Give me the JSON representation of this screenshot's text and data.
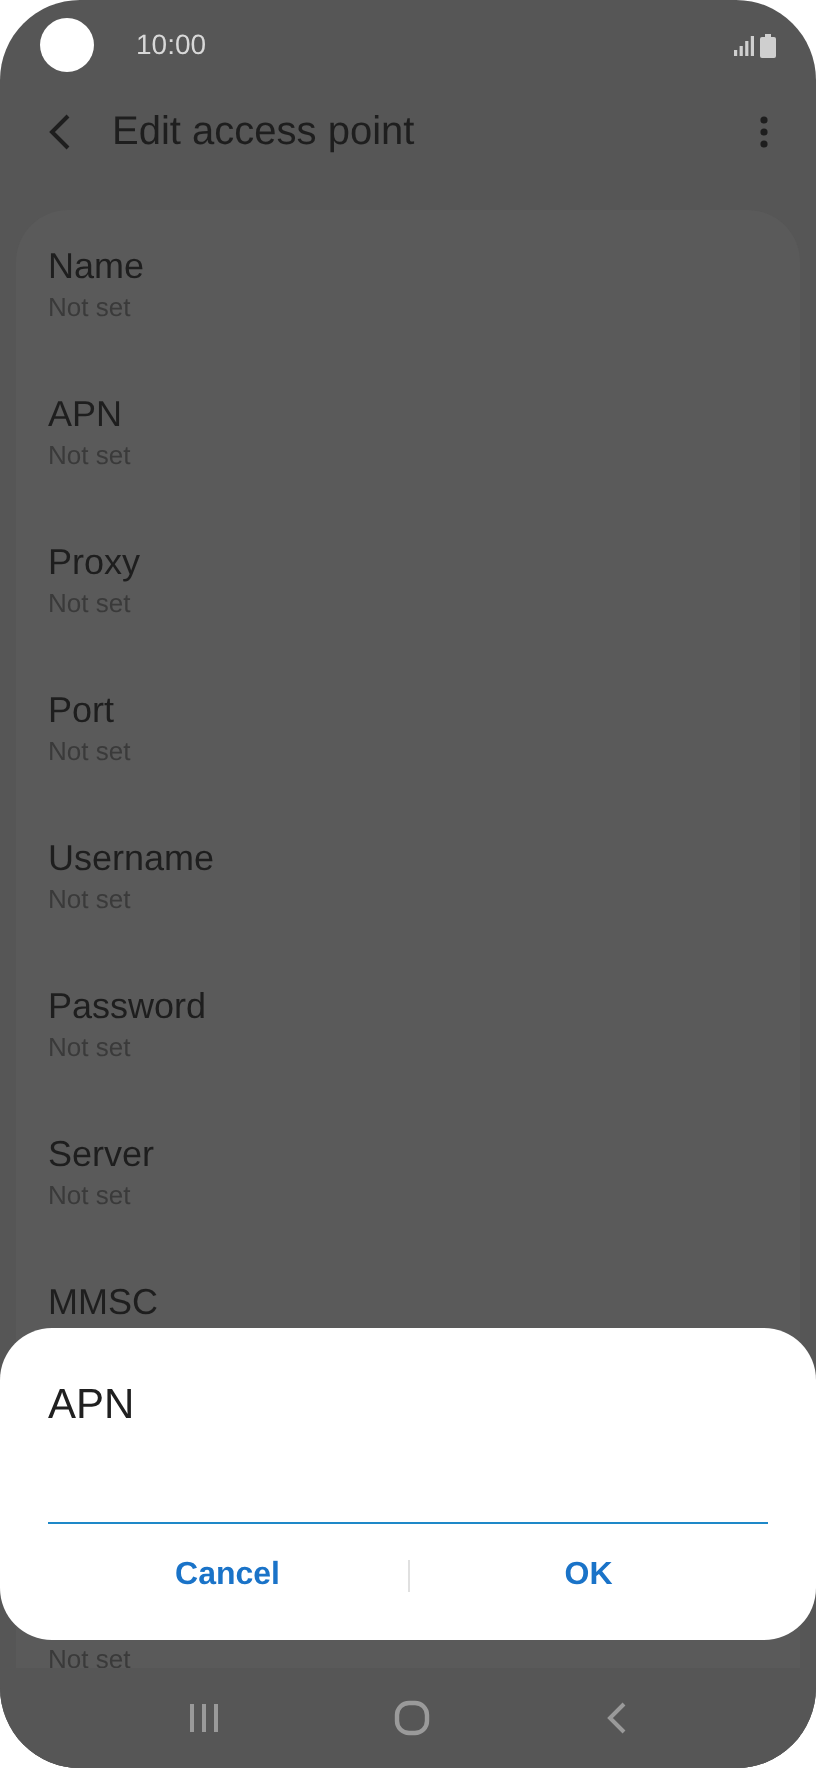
{
  "status_bar": {
    "time": "10:00"
  },
  "header": {
    "title": "Edit access point"
  },
  "settings": [
    {
      "title": "Name",
      "value": "Not set"
    },
    {
      "title": "APN",
      "value": "Not set"
    },
    {
      "title": "Proxy",
      "value": "Not set"
    },
    {
      "title": "Port",
      "value": "Not set"
    },
    {
      "title": "Username",
      "value": "Not set"
    },
    {
      "title": "Password",
      "value": "Not set"
    },
    {
      "title": "Server",
      "value": "Not set"
    },
    {
      "title": "MMSC"
    },
    {
      "value": "Not set"
    }
  ],
  "dialog": {
    "title": "APN",
    "buttons": [
      "Cancel",
      "OK"
    ]
  }
}
